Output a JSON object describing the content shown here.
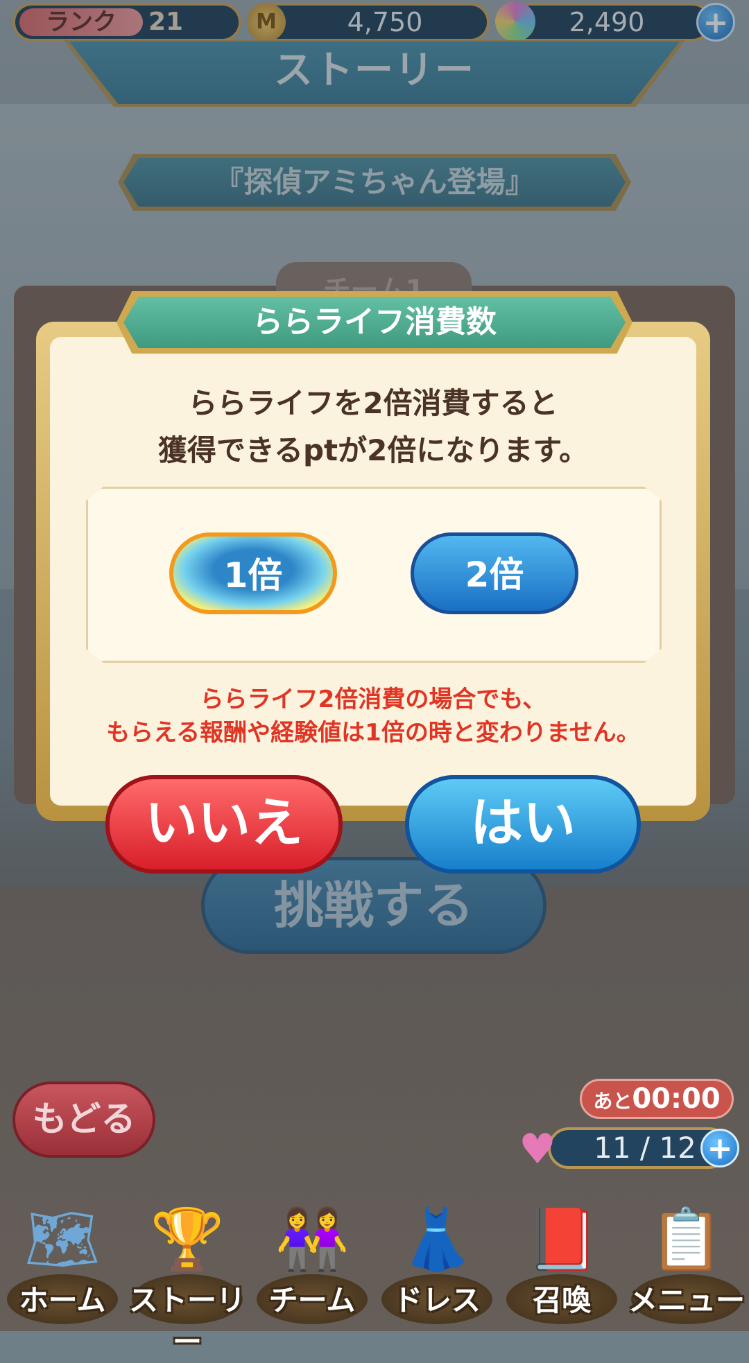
{
  "status_bar": {
    "rank_label": "ランク",
    "rank_value": "21",
    "coin_symbol": "M",
    "coins": "4,750",
    "gems": "2,490",
    "plus": "+"
  },
  "header": {
    "title": "ストーリー"
  },
  "episode": {
    "title": "『探偵アミちゃん登場』"
  },
  "team": {
    "tab_label": "チーム1"
  },
  "challenge_button": "挑戦する",
  "dialog": {
    "title": "ららライフ消費数",
    "message_line1": "ららライフを2倍消費すると",
    "message_line2": "獲得できるptが2倍になります。",
    "option_1x": "1倍",
    "option_2x": "2倍",
    "selected_option": "1倍",
    "note_line1": "ららライフ2倍消費の場合でも、",
    "note_line2": "もらえる報酬や経験値は1倍の時と変わりません。",
    "no_button": "いいえ",
    "yes_button": "はい"
  },
  "back_button": "もどる",
  "life": {
    "timer_prefix": "あと",
    "timer": "00:00",
    "value": "11 / 12"
  },
  "nav": [
    {
      "label": "ホーム",
      "icon": "map-icon"
    },
    {
      "label": "ストーリー",
      "icon": "trophy-icon"
    },
    {
      "label": "チーム",
      "icon": "team-icon"
    },
    {
      "label": "ドレス",
      "icon": "dress-icon"
    },
    {
      "label": "召喚",
      "icon": "book-icon"
    },
    {
      "label": "メニュー",
      "icon": "menu-icon"
    }
  ],
  "colors": {
    "dialog_bg": "#fbf3de",
    "title_green": "#3f9a80",
    "note_red": "#e03524",
    "no_red": "#d81f2a",
    "yes_blue": "#1780cc"
  }
}
